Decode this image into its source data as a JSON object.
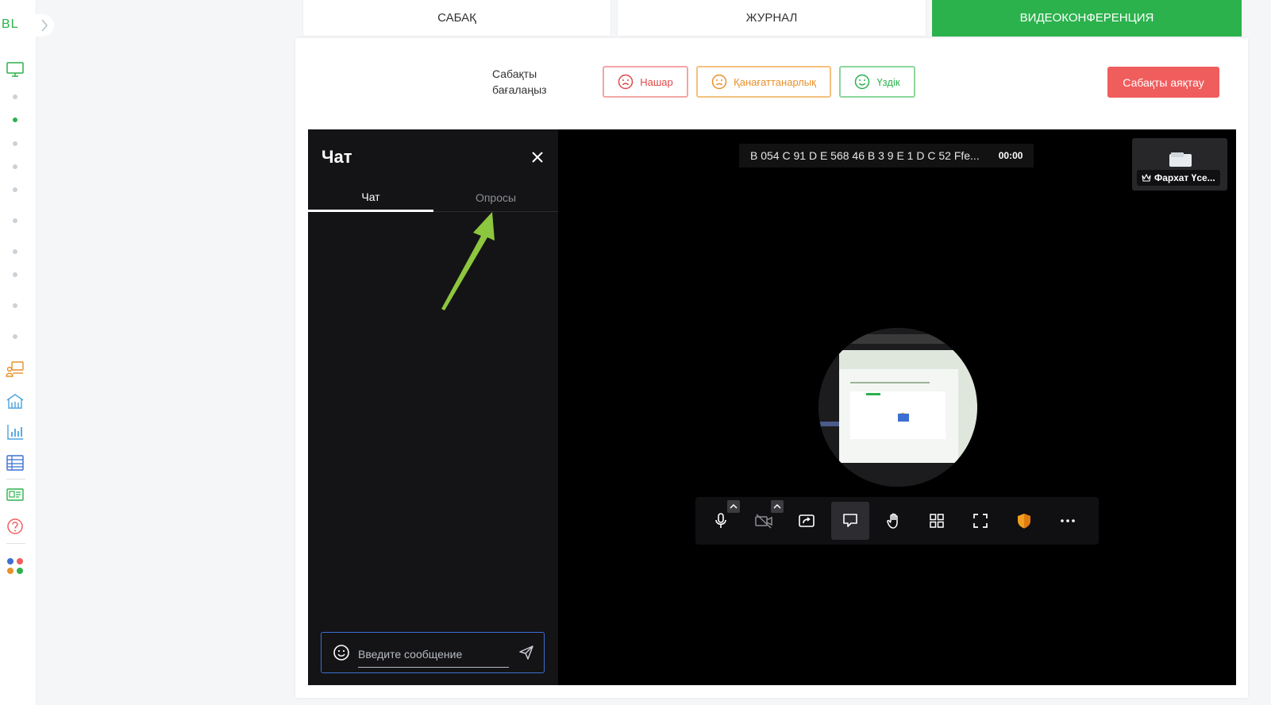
{
  "sidebar": {
    "logo": "BL",
    "icons": [
      "monitor-icon",
      "presentation-icon",
      "school-icon",
      "chart-icon",
      "table-icon",
      "id-card-icon",
      "help-icon",
      "apps-icon"
    ]
  },
  "tabs": [
    {
      "label": "САБАҚ",
      "active": false
    },
    {
      "label": "ЖУРНАЛ",
      "active": false
    },
    {
      "label": "ВИДЕОКОНФЕРЕНЦИЯ",
      "active": true
    }
  ],
  "rating": {
    "label_line1": "Сабақты",
    "label_line2": "бағалаңыз",
    "bad": "Нашар",
    "ok": "Қанағаттанарлық",
    "good": "Үздік"
  },
  "finish_label": "Сабақты аяқтау",
  "chat": {
    "title": "Чат",
    "tab_chat": "Чат",
    "tab_polls": "Опросы",
    "input_placeholder": "Введите сообщение"
  },
  "stage": {
    "room_name": "B 054 C 91 D E 568 46 B 3 9 E 1 D C 52 Ffe...",
    "timer": "00:00",
    "participant_name": "Фархат Үсе..."
  },
  "colors": {
    "accent": "#2bb24c",
    "danger": "#f05d5d",
    "warning": "#e8912b",
    "arrow": "#8dc63f"
  }
}
